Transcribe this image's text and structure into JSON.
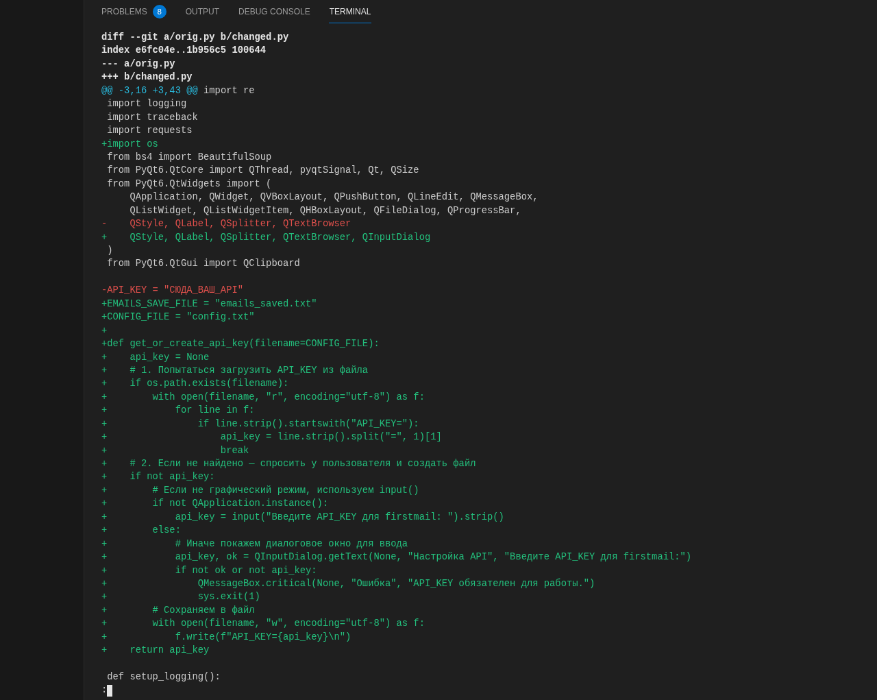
{
  "tabs": [
    {
      "label": "PROBLEMS",
      "selected": false,
      "badge": "8"
    },
    {
      "label": "OUTPUT",
      "selected": false
    },
    {
      "label": "DEBUG CONSOLE",
      "selected": false
    },
    {
      "label": "TERMINAL",
      "selected": true
    }
  ],
  "terminal": {
    "lines": [
      {
        "kind": "header",
        "text": "diff --git a/orig.py b/changed.py"
      },
      {
        "kind": "header",
        "text": "index e6fc04e..1b956c5 100644"
      },
      {
        "kind": "header",
        "text": "--- a/orig.py"
      },
      {
        "kind": "header",
        "text": "+++ b/changed.py"
      },
      {
        "kind": "hunk",
        "text": "@@ -3,16 +3,43 @@",
        "context": "import re"
      },
      {
        "kind": "context",
        "text": " import logging"
      },
      {
        "kind": "context",
        "text": " import traceback"
      },
      {
        "kind": "context",
        "text": " import requests"
      },
      {
        "kind": "add",
        "text": "+import os"
      },
      {
        "kind": "context",
        "text": " from bs4 import BeautifulSoup"
      },
      {
        "kind": "context",
        "text": " from PyQt6.QtCore import QThread, pyqtSignal, Qt, QSize"
      },
      {
        "kind": "context",
        "text": " from PyQt6.QtWidgets import ("
      },
      {
        "kind": "context",
        "text": "     QApplication, QWidget, QVBoxLayout, QPushButton, QLineEdit, QMessageBox,"
      },
      {
        "kind": "context",
        "text": "     QListWidget, QListWidgetItem, QHBoxLayout, QFileDialog, QProgressBar,"
      },
      {
        "kind": "del",
        "text": "-    QStyle, QLabel, QSplitter, QTextBrowser"
      },
      {
        "kind": "add",
        "text": "+    QStyle, QLabel, QSplitter, QTextBrowser, QInputDialog"
      },
      {
        "kind": "context",
        "text": " )"
      },
      {
        "kind": "context",
        "text": " from PyQt6.QtGui import QClipboard"
      },
      {
        "kind": "blank"
      },
      {
        "kind": "del",
        "text": "-API_KEY = \"СЮДА_ВАШ_API\""
      },
      {
        "kind": "add",
        "text": "+EMAILS_SAVE_FILE = \"emails_saved.txt\""
      },
      {
        "kind": "add",
        "text": "+CONFIG_FILE = \"config.txt\""
      },
      {
        "kind": "add",
        "text": "+"
      },
      {
        "kind": "add",
        "text": "+def get_or_create_api_key(filename=CONFIG_FILE):"
      },
      {
        "kind": "add",
        "text": "+    api_key = None"
      },
      {
        "kind": "add",
        "text": "+    # 1. Попытаться загрузить API_KEY из файла"
      },
      {
        "kind": "add",
        "text": "+    if os.path.exists(filename):"
      },
      {
        "kind": "add",
        "text": "+        with open(filename, \"r\", encoding=\"utf-8\") as f:"
      },
      {
        "kind": "add",
        "text": "+            for line in f:"
      },
      {
        "kind": "add",
        "text": "+                if line.strip().startswith(\"API_KEY=\"):"
      },
      {
        "kind": "add",
        "text": "+                    api_key = line.strip().split(\"=\", 1)[1]"
      },
      {
        "kind": "add",
        "text": "+                    break"
      },
      {
        "kind": "add",
        "text": "+    # 2. Если не найдено — спросить у пользователя и создать файл"
      },
      {
        "kind": "add",
        "text": "+    if not api_key:"
      },
      {
        "kind": "add",
        "text": "+        # Если не графический режим, используем input()"
      },
      {
        "kind": "add",
        "text": "+        if not QApplication.instance():"
      },
      {
        "kind": "add",
        "text": "+            api_key = input(\"Введите API_KEY для firstmail: \").strip()"
      },
      {
        "kind": "add",
        "text": "+        else:"
      },
      {
        "kind": "add",
        "text": "+            # Иначе покажем диалоговое окно для ввода"
      },
      {
        "kind": "add",
        "text": "+            api_key, ok = QInputDialog.getText(None, \"Настройка API\", \"Введите API_KEY для firstmail:\")"
      },
      {
        "kind": "add",
        "text": "+            if not ok or not api_key:"
      },
      {
        "kind": "add",
        "text": "+                QMessageBox.critical(None, \"Ошибка\", \"API_KEY обязателен для работы.\")"
      },
      {
        "kind": "add",
        "text": "+                sys.exit(1)"
      },
      {
        "kind": "add",
        "text": "+        # Сохраняем в файл"
      },
      {
        "kind": "add",
        "text": "+        with open(filename, \"w\", encoding=\"utf-8\") as f:"
      },
      {
        "kind": "add",
        "text": "+            f.write(f\"API_KEY={api_key}\\n\")"
      },
      {
        "kind": "add",
        "text": "+    return api_key"
      },
      {
        "kind": "blank"
      },
      {
        "kind": "context",
        "text": " def setup_logging():"
      },
      {
        "kind": "prompt",
        "text": ":"
      }
    ]
  }
}
